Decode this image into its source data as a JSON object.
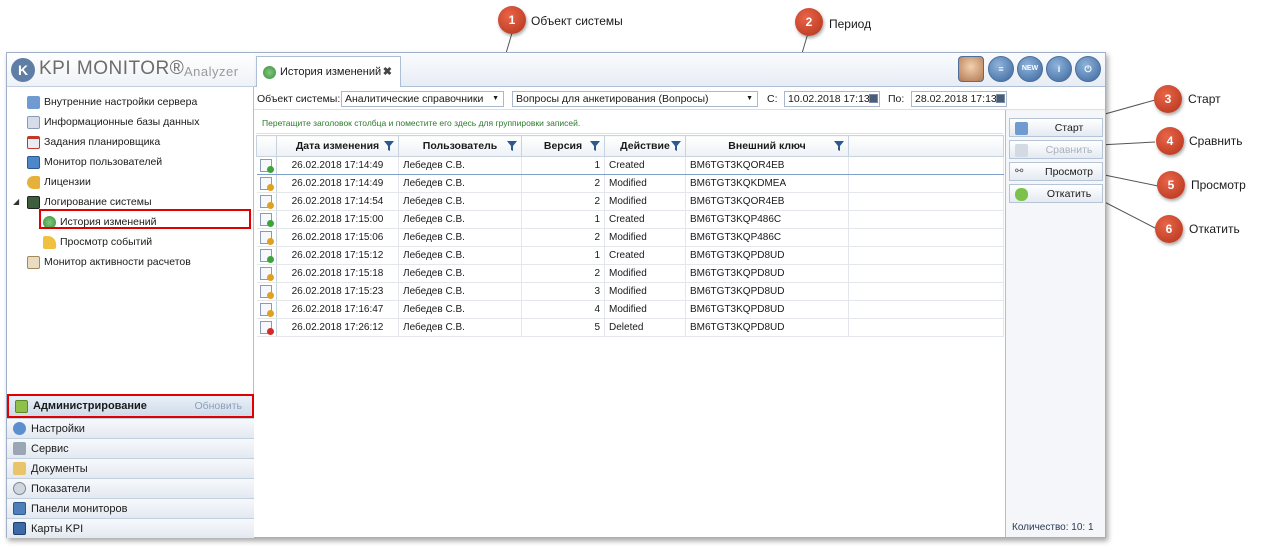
{
  "app": {
    "logo_mark": "K",
    "logo_text": "KPI MONITOR®",
    "logo_sub": "Analyzer"
  },
  "tree": {
    "items": [
      {
        "label": "Внутренние настройки сервера",
        "icon": "server-settings-icon"
      },
      {
        "label": "Информационные базы данных",
        "icon": "database-icon"
      },
      {
        "label": "Задания планировщика",
        "icon": "calendar-icon"
      },
      {
        "label": "Монитор пользователей",
        "icon": "monitor-icon"
      },
      {
        "label": "Лицензии",
        "icon": "key-icon"
      },
      {
        "label": "Логирование системы",
        "icon": "log-icon"
      },
      {
        "label": "История изменений",
        "icon": "history-icon"
      },
      {
        "label": "Просмотр событий",
        "icon": "events-icon"
      },
      {
        "label": "Монитор активности расчетов",
        "icon": "activity-icon"
      }
    ]
  },
  "nav": {
    "active_label": "Администрирование",
    "refresh_label": "Обновить",
    "items": [
      {
        "label": "Настройки"
      },
      {
        "label": "Сервис"
      },
      {
        "label": "Документы"
      },
      {
        "label": "Показатели"
      },
      {
        "label": "Панели мониторов"
      },
      {
        "label": "Карты KPI"
      }
    ]
  },
  "tab": {
    "label": "История изменений",
    "close": "✖"
  },
  "toolbar": {
    "new_label": "NEW",
    "info_label": "i",
    "power_label": "⏻"
  },
  "filter": {
    "object_label": "Объект системы:",
    "object_value": "Аналитические справочники",
    "sub_value": "Вопросы для анкетирования (Вопросы)",
    "from_label": "С:",
    "from_value": "10.02.2018 17:13",
    "to_label": "По:",
    "to_value": "28.02.2018 17:13"
  },
  "grid": {
    "group_hint": "Перетащите заголовок столбца и поместите его здесь для группировки записей.",
    "columns": [
      "Дата изменения",
      "Пользователь",
      "Версия",
      "Действие",
      "Внешний ключ"
    ],
    "rows": [
      {
        "date": "26.02.2018 17:14:49",
        "user": "Лебедев С.В.",
        "version": "1",
        "action": "Created",
        "key": "BM6TGT3KQOR4EB",
        "kind": "created"
      },
      {
        "date": "26.02.2018 17:14:49",
        "user": "Лебедев С.В.",
        "version": "2",
        "action": "Modified",
        "key": "BM6TGT3KQKDMEA",
        "kind": "modified"
      },
      {
        "date": "26.02.2018 17:14:54",
        "user": "Лебедев С.В.",
        "version": "2",
        "action": "Modified",
        "key": "BM6TGT3KQOR4EB",
        "kind": "modified"
      },
      {
        "date": "26.02.2018 17:15:00",
        "user": "Лебедев С.В.",
        "version": "1",
        "action": "Created",
        "key": "BM6TGT3KQP486C",
        "kind": "created"
      },
      {
        "date": "26.02.2018 17:15:06",
        "user": "Лебедев С.В.",
        "version": "2",
        "action": "Modified",
        "key": "BM6TGT3KQP486C",
        "kind": "modified"
      },
      {
        "date": "26.02.2018 17:15:12",
        "user": "Лебедев С.В.",
        "version": "1",
        "action": "Created",
        "key": "BM6TGT3KQPD8UD",
        "kind": "created"
      },
      {
        "date": "26.02.2018 17:15:18",
        "user": "Лебедев С.В.",
        "version": "2",
        "action": "Modified",
        "key": "BM6TGT3KQPD8UD",
        "kind": "modified"
      },
      {
        "date": "26.02.2018 17:15:23",
        "user": "Лебедев С.В.",
        "version": "3",
        "action": "Modified",
        "key": "BM6TGT3KQPD8UD",
        "kind": "modified"
      },
      {
        "date": "26.02.2018 17:16:47",
        "user": "Лебедев С.В.",
        "version": "4",
        "action": "Modified",
        "key": "BM6TGT3KQPD8UD",
        "kind": "modified"
      },
      {
        "date": "26.02.2018 17:26:12",
        "user": "Лебедев С.В.",
        "version": "5",
        "action": "Deleted",
        "key": "BM6TGT3KQPD8UD",
        "kind": "deleted"
      }
    ]
  },
  "actions": {
    "start": "Старт",
    "compare": "Сравнить",
    "view": "Просмотр",
    "rollback": "Откатить",
    "count": "Количество: 10: 1"
  },
  "callouts": [
    {
      "num": "1",
      "label": "Объект системы"
    },
    {
      "num": "2",
      "label": "Период"
    },
    {
      "num": "3",
      "label": "Старт"
    },
    {
      "num": "4",
      "label": "Сравнить"
    },
    {
      "num": "5",
      "label": "Просмотр"
    },
    {
      "num": "6",
      "label": "Откатить"
    }
  ],
  "colors": {
    "accent": "#3b679c",
    "highlight": "#e00000",
    "callout": "#c0391e",
    "hint_text": "#2c7a2c",
    "created": "#3aa63a",
    "modified": "#e0a020",
    "deleted": "#d42a2a"
  }
}
